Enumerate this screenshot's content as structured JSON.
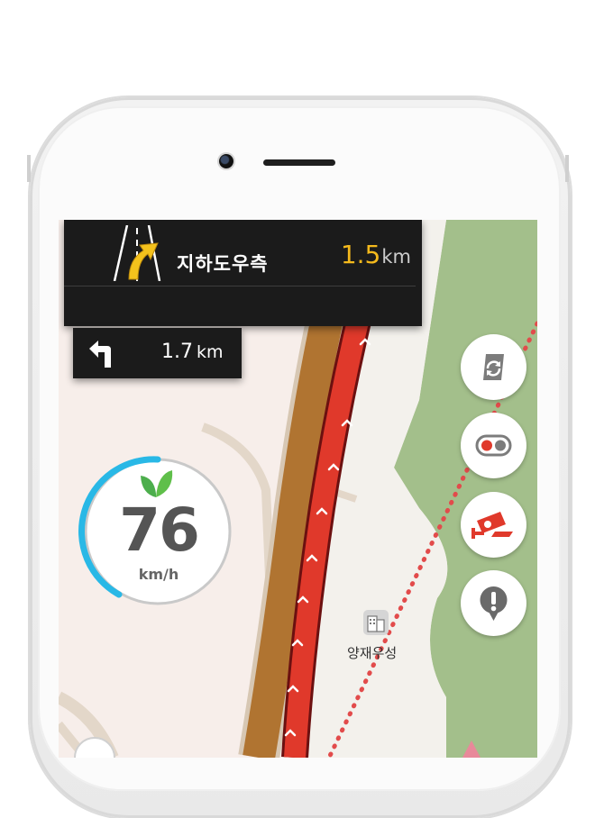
{
  "guidance": {
    "road_name": "지하도우측",
    "distance_value": "1.5",
    "distance_unit": "km",
    "lane_icon": "lane-keep-right-arrow-icon",
    "accent_color": "#f4b91c"
  },
  "next_turn": {
    "direction_icon": "turn-left-arrow-icon",
    "distance_value": "1.7",
    "distance_unit": "km"
  },
  "speed": {
    "value": "76",
    "unit": "km/h",
    "eco_icon": "eco-leaf-icon",
    "ring_color": "#29b8e6",
    "ring_fraction": 0.38
  },
  "map": {
    "poi_label": "양재우성",
    "poi_icon": "building-icon",
    "route_color": "#e0392b",
    "road_color": "#b07431",
    "park_color": "#a3bf8b"
  },
  "buttons": [
    {
      "name": "reroute-button",
      "icon": "reroute-icon"
    },
    {
      "name": "traffic-light-button",
      "icon": "traffic-light-icon"
    },
    {
      "name": "speed-camera-button",
      "icon": "speed-camera-icon"
    },
    {
      "name": "report-button",
      "icon": "alert-icon"
    }
  ]
}
